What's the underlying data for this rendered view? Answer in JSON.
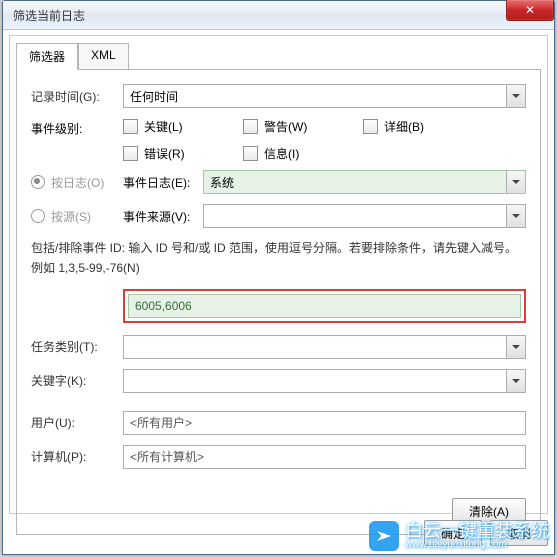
{
  "window": {
    "title": "筛选当前日志"
  },
  "tabs": {
    "filter": "筛选器",
    "xml": "XML"
  },
  "labels": {
    "logged": "记录时间(G):",
    "level": "事件级别:",
    "by_log": "按日志(O)",
    "by_source": "按源(S)",
    "event_log": "事件日志(E):",
    "event_source": "事件来源(V):",
    "task": "任务类别(T):",
    "keyword": "关键字(K):",
    "user": "用户(U):",
    "computer": "计算机(P):"
  },
  "values": {
    "logged": "任何时间",
    "event_log": "系统",
    "event_source": "",
    "event_id": "6005,6006",
    "task": "",
    "keyword": "",
    "user": "<所有用户>",
    "computer": "<所有计算机>"
  },
  "checkboxes": {
    "critical": "关键(L)",
    "warning": "警告(W)",
    "verbose": "详细(B)",
    "error": "错误(R)",
    "info": "信息(I)"
  },
  "desc": "包括/排除事件 ID: 输入 ID 号和/或 ID 范围，使用逗号分隔。若要排除条件，请先键入减号。例如 1,3,5-99,-76(N)",
  "buttons": {
    "clear": "清除(A)",
    "ok": "确定",
    "cancel": "取消"
  },
  "watermark": {
    "text": "白云一键重装系统",
    "url": "www.baiyunxitong.com"
  }
}
